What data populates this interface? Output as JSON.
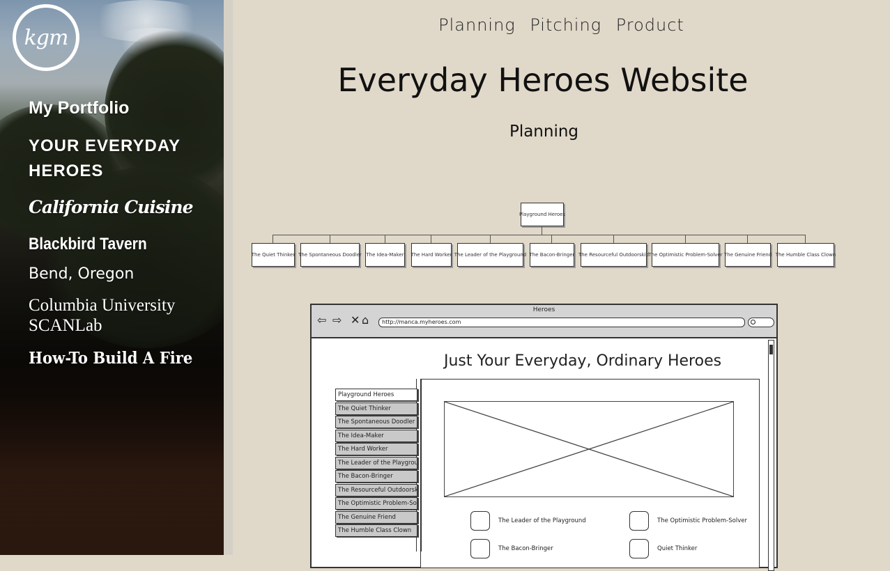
{
  "sidebar": {
    "logo_text": "kgm",
    "items": [
      {
        "label": "My Portfolio"
      },
      {
        "label": "YOUR EVERYDAY HEROES"
      },
      {
        "label": "California Cuisine"
      },
      {
        "label": "Blackbird Tavern"
      },
      {
        "label": "Bend, Oregon"
      },
      {
        "label": "Columbia University SCANLab"
      },
      {
        "label": "How-To Build A Fire"
      }
    ]
  },
  "topnav": [
    "Planning",
    "Pitching",
    "Product"
  ],
  "page": {
    "title": "Everyday Heroes Website",
    "section": "Planning"
  },
  "sitemap": {
    "root": "Playground Heroes",
    "children": [
      "The Quiet Thinker",
      "The Spontaneous Doodler",
      "The Idea-Maker",
      "The Hard Worker",
      "The Leader of the Playground",
      "The Bacon-Bringer",
      "The Resourceful Outdoorskid",
      "The Optimistic Problem-Solver",
      "The Genuine Friend",
      "The Humble Class Clown"
    ]
  },
  "wireframe": {
    "window_title": "Heroes",
    "url": "http://manca.myheroes.com",
    "heading": "Just Your Everyday, Ordinary Heroes",
    "menu": [
      "Playground Heroes",
      "The Quiet Thinker",
      "The Spontaneous Doodler",
      "The Idea-Maker",
      "The Hard Worker",
      "The Leader of the Playground",
      "The Bacon-Bringer",
      "The Resourceful Outdoorskid",
      "The Optimistic Problem-Solver",
      "The Genuine Friend",
      "The Humble Class Clown"
    ],
    "heroes": [
      "The Leader of the Playground",
      "The Optimistic Problem-Solver",
      "The Bacon-Bringer",
      "Quiet Thinker"
    ]
  }
}
